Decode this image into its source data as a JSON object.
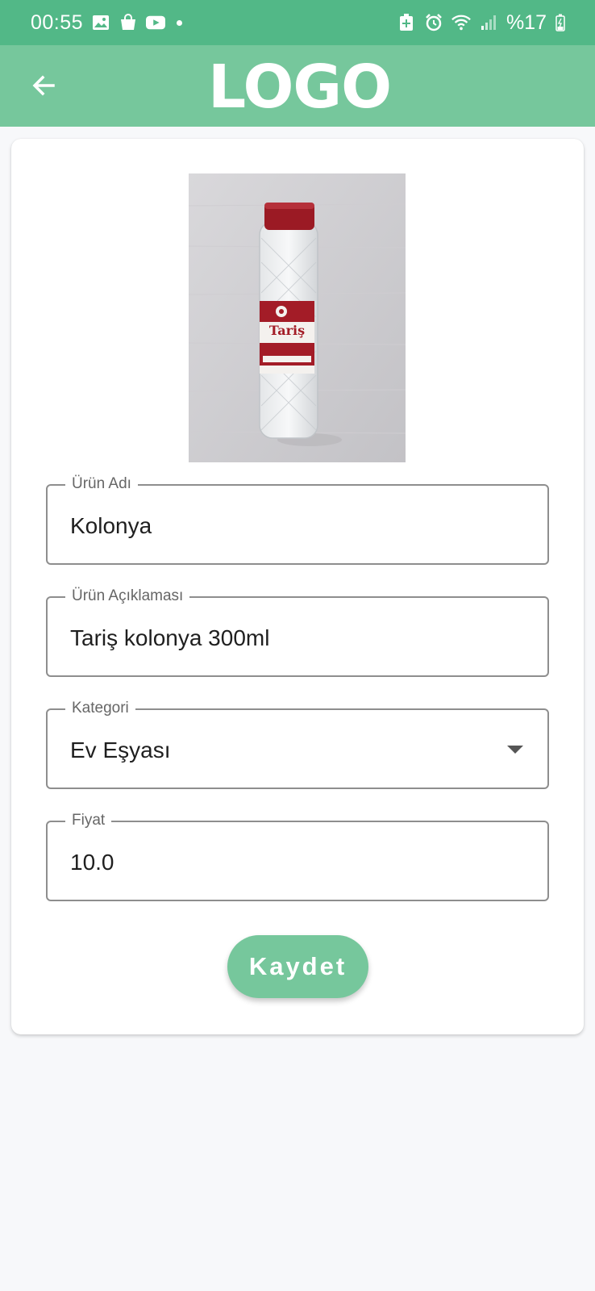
{
  "status_bar": {
    "time": "00:55",
    "battery": "%17",
    "icons_left": [
      "gallery-icon",
      "shopping-bag-icon",
      "youtube-icon",
      "notification-dot-icon"
    ],
    "icons_right": [
      "battery-saver-icon",
      "alarm-icon",
      "wifi-icon",
      "signal-icon",
      "charging-battery-icon"
    ]
  },
  "app_bar": {
    "logo": "LOGO",
    "back_icon": "arrow-back-icon",
    "color": "#76c79c"
  },
  "form": {
    "image_alt": "Tariş",
    "fields": [
      {
        "label": "Ürün Adı",
        "value": "Kolonya"
      },
      {
        "label": "Ürün Açıklaması",
        "value": "Tariş kolonya 300ml"
      },
      {
        "label": "Kategori",
        "value": "Ev Eşyası"
      },
      {
        "label": "Fiyat",
        "value": "10.0"
      }
    ],
    "save_label": "Kaydet"
  },
  "colors": {
    "status_bar": "#52b887",
    "accent": "#76c79c",
    "background": "#f7f8fa"
  }
}
